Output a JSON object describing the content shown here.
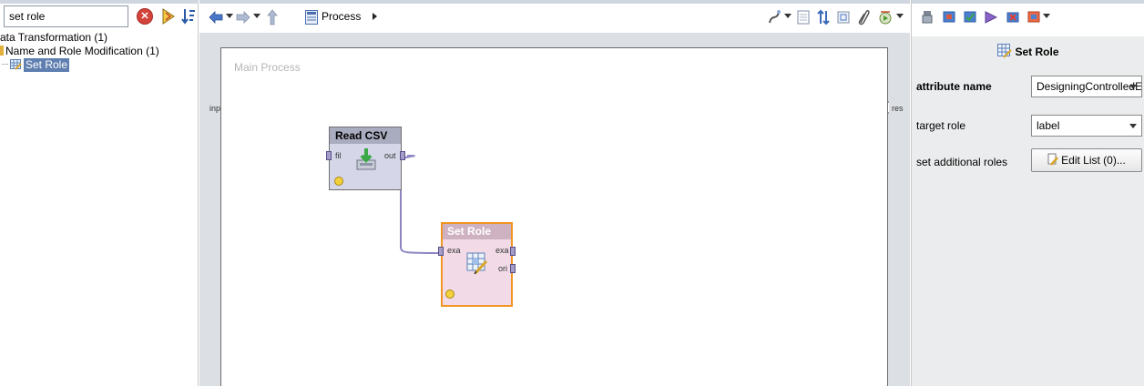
{
  "search": {
    "value": "set role"
  },
  "tree": {
    "items": [
      {
        "label": "ata Transformation (1)"
      },
      {
        "label": "Name and Role Modification (1)"
      },
      {
        "label": "Set Role"
      }
    ]
  },
  "toolbar": {
    "breadcrumb": "Process"
  },
  "canvas": {
    "title": "Main Process",
    "left_port": "inp",
    "right_port": "res"
  },
  "operators": {
    "read_csv": {
      "title": "Read CSV",
      "in_port": "fil",
      "out_port": "out"
    },
    "set_role": {
      "title": "Set Role",
      "in_port": "exa",
      "out_port_1": "exa",
      "out_port_2": "ori"
    }
  },
  "params": {
    "header": "Set Role",
    "attribute_name_label": "attribute name",
    "attribute_name_value": "DesigningControlledE",
    "target_role_label": "target role",
    "target_role_value": "label",
    "additional_roles_label": "set additional roles",
    "edit_list_label": "Edit List (0)..."
  },
  "colors": {
    "selection": "#5f7fb0",
    "operator_highlight": "#f09422",
    "canvas_border": "#6d6d6d",
    "port_fill": "#a59cc8"
  }
}
